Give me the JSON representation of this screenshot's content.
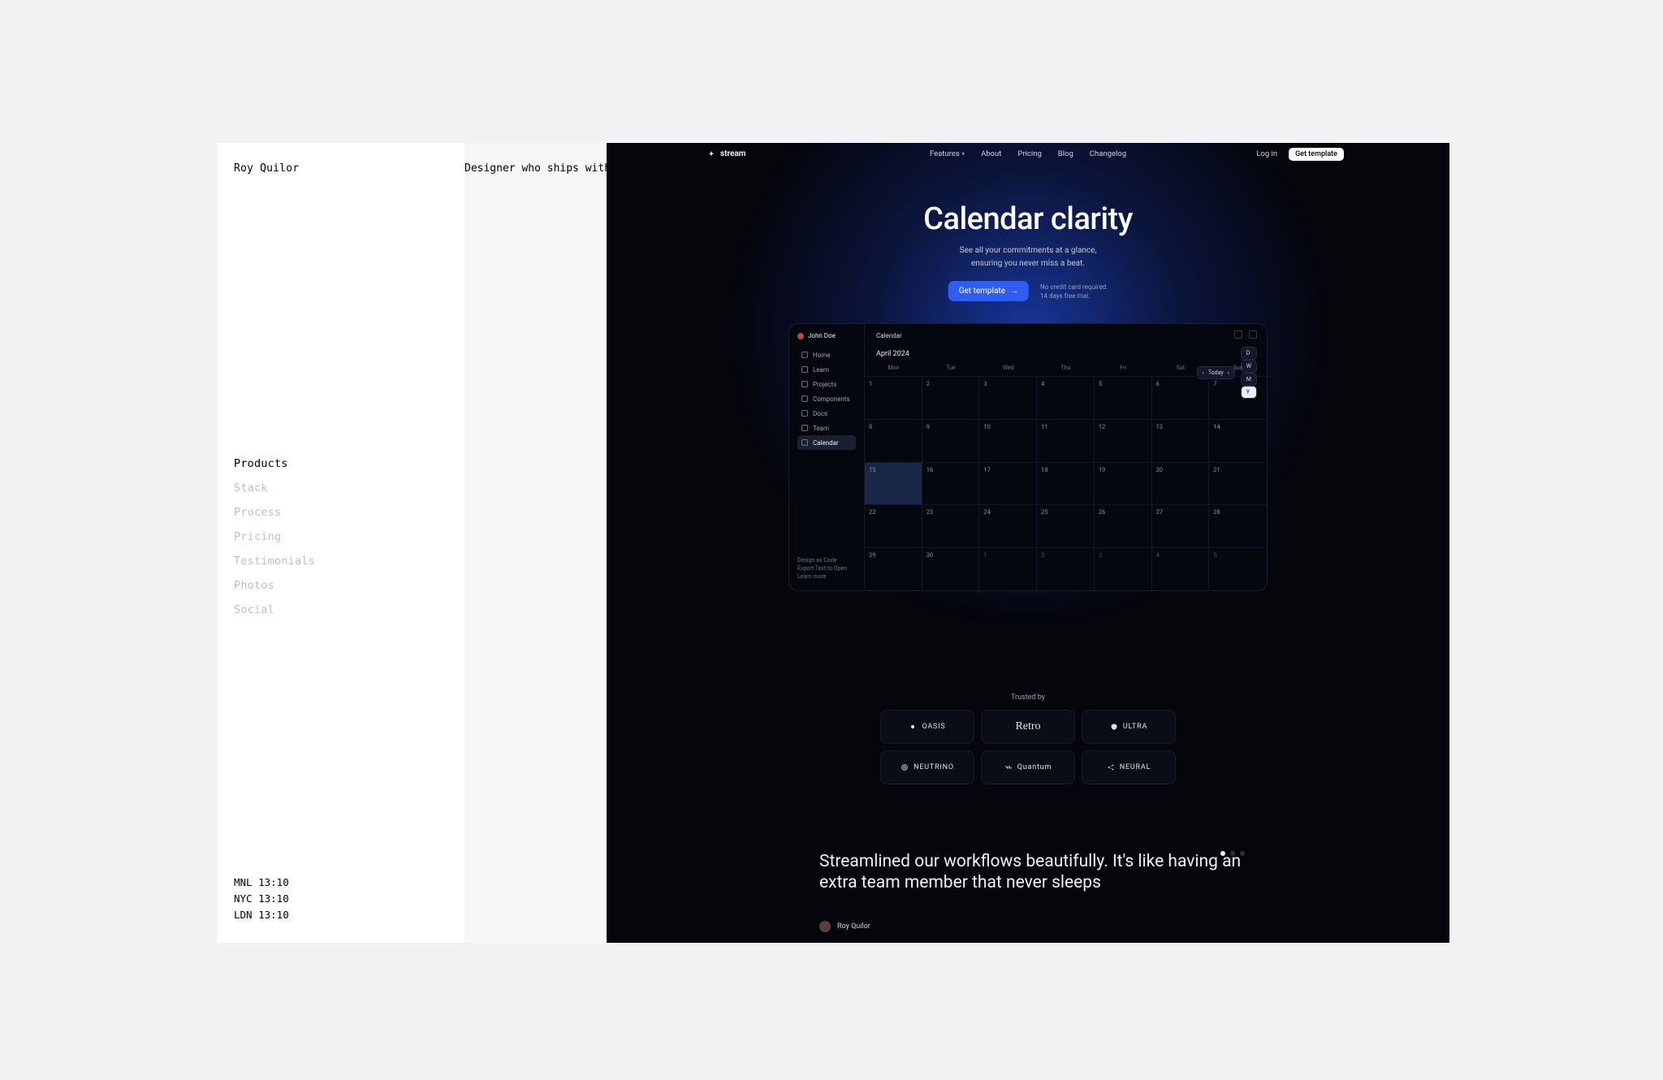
{
  "outer": {
    "brand": "Roy Quilor",
    "tagline": "Designer who ships with AI.",
    "nav": [
      "Products",
      "Stack",
      "Process",
      "Pricing",
      "Testimonials",
      "Photos",
      "Social"
    ],
    "nav_active": 0,
    "clocks": [
      {
        "city": "MNL",
        "time": "13:10"
      },
      {
        "city": "NYC",
        "time": "13:10"
      },
      {
        "city": "LDN",
        "time": "13:10"
      }
    ]
  },
  "hero": {
    "brand": "stream",
    "nav": [
      "Features",
      "About",
      "Pricing",
      "Blog",
      "Changelog"
    ],
    "login": "Log in",
    "cta_pill": "Get template",
    "title": "Calendar clarity",
    "sub1": "See all your commitments at a glance,",
    "sub2": "ensuring you never miss a beat.",
    "cta": "Get template",
    "note1": "No credit card required.",
    "note2": "14 days free trial."
  },
  "cal": {
    "user": "John Doe",
    "crumb": "Calendar",
    "month": "April 2024",
    "today": "Today",
    "views": [
      "D",
      "W",
      "M",
      "Y"
    ],
    "view_active": 3,
    "side": [
      "Home",
      "Learn",
      "Projects",
      "Components",
      "Docs",
      "Team",
      "Calendar"
    ],
    "side_active": 6,
    "bottom1": "Design as Code",
    "bottom2": "Export Text to Open",
    "bottom3": "Learn more",
    "days": [
      "Mon",
      "Tue",
      "Wed",
      "Thu",
      "Fri",
      "Sat",
      "Sun"
    ],
    "weeks": [
      [
        {
          "n": "1"
        },
        {
          "n": "2"
        },
        {
          "n": "3"
        },
        {
          "n": "4"
        },
        {
          "n": "5"
        },
        {
          "n": "6"
        },
        {
          "n": "7"
        }
      ],
      [
        {
          "n": "8"
        },
        {
          "n": "9"
        },
        {
          "n": "10"
        },
        {
          "n": "11"
        },
        {
          "n": "12"
        },
        {
          "n": "13"
        },
        {
          "n": "14"
        }
      ],
      [
        {
          "n": "15",
          "today": true
        },
        {
          "n": "16"
        },
        {
          "n": "17"
        },
        {
          "n": "18"
        },
        {
          "n": "19"
        },
        {
          "n": "20"
        },
        {
          "n": "21"
        }
      ],
      [
        {
          "n": "22"
        },
        {
          "n": "23"
        },
        {
          "n": "24"
        },
        {
          "n": "25"
        },
        {
          "n": "26"
        },
        {
          "n": "27"
        },
        {
          "n": "28"
        }
      ],
      [
        {
          "n": "29"
        },
        {
          "n": "30"
        },
        {
          "n": "1",
          "dim": true
        },
        {
          "n": "2",
          "dim": true
        },
        {
          "n": "3",
          "dim": true
        },
        {
          "n": "4",
          "dim": true
        },
        {
          "n": "5",
          "dim": true
        }
      ]
    ]
  },
  "trusted": {
    "label": "Trusted by",
    "logos": [
      "OASIS",
      "Retro",
      "ULTRA",
      "NEUTRINO",
      "Quantum",
      "NEURAL"
    ]
  },
  "testimonial": {
    "quote": "Streamlined our workflows beautifully. It's like having an extra team member that never sleeps",
    "author": "Roy Quilor"
  }
}
